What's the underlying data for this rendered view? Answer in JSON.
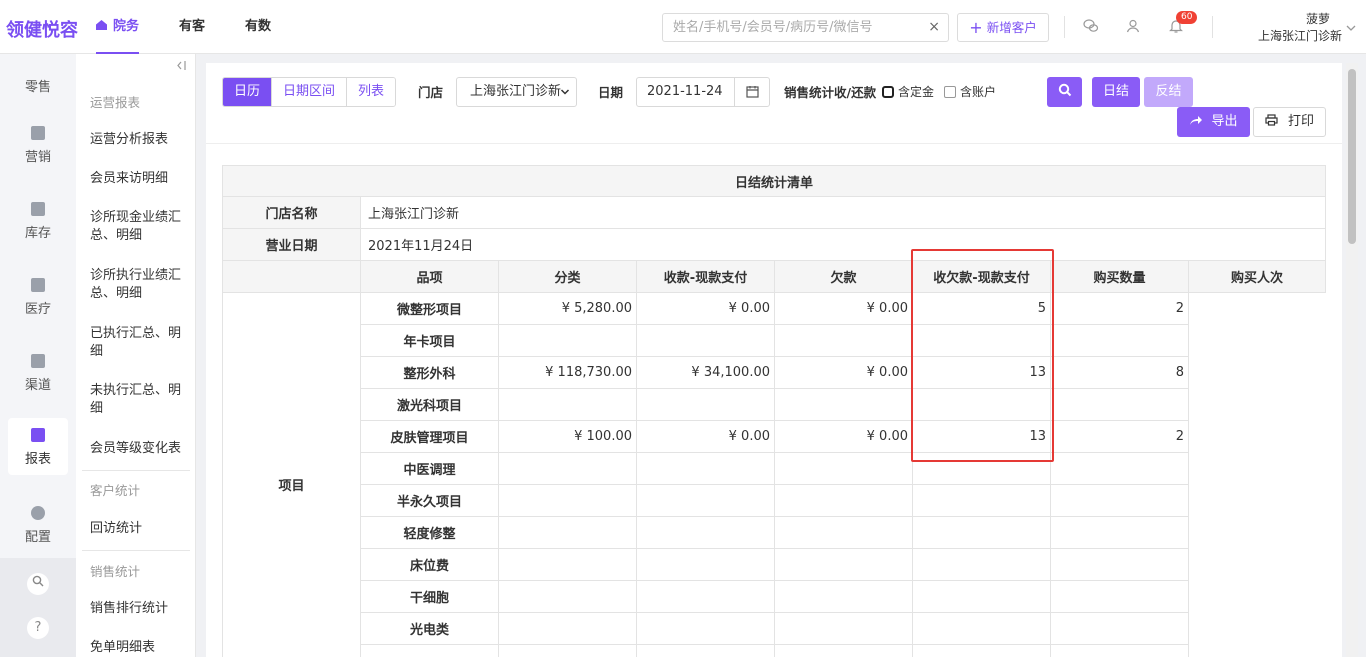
{
  "app": {
    "logo": "领健悦容"
  },
  "topnav": [
    {
      "label": "院务",
      "active": true
    },
    {
      "label": "有客",
      "active": false
    },
    {
      "label": "有数",
      "active": false
    }
  ],
  "search": {
    "placeholder": "姓名/手机号/会员号/病历号/微信号",
    "clear_icon": "×"
  },
  "add_customer": {
    "label": "新增客户"
  },
  "notifications": {
    "count": "60"
  },
  "user": {
    "name": "菠萝",
    "clinic": "上海张江门诊新"
  },
  "rail": [
    {
      "label": "零售",
      "icon": "retail-icon"
    },
    {
      "label": "营销",
      "icon": "marketing-icon"
    },
    {
      "label": "库存",
      "icon": "inventory-icon"
    },
    {
      "label": "医疗",
      "icon": "medical-icon"
    },
    {
      "label": "渠道",
      "icon": "channel-icon"
    },
    {
      "label": "报表",
      "icon": "report-icon",
      "active": true
    },
    {
      "label": "配置",
      "icon": "settings-icon"
    }
  ],
  "submenu": {
    "group_ops": "运营报表",
    "ops_items": [
      "运营分析报表",
      "会员来访明细",
      "诊所现金业绩汇总、明细",
      "诊所执行业绩汇总、明细",
      "已执行汇总、明细",
      "未执行汇总、明细",
      "会员等级变化表"
    ],
    "group_customer": "客户统计",
    "customer_items": [
      "回访统计"
    ],
    "group_sales": "销售统计",
    "sales_items": [
      "销售排行统计",
      "免单明细表"
    ]
  },
  "filters": {
    "view_tabs": [
      {
        "label": "日历",
        "active": true
      },
      {
        "label": "日期区间",
        "active": false
      },
      {
        "label": "列表",
        "active": false
      }
    ],
    "store_label": "门店",
    "store_value": "上海张江门诊新",
    "date_label": "日期",
    "date_value": "2021-11-24",
    "sales_stat_label": "销售统计收/还款",
    "include_deposit_label": "含定金",
    "include_account_label": "含账户",
    "settle_label": "日结",
    "unsettle_label": "反结",
    "export_label": "导出",
    "print_label": "打印"
  },
  "report": {
    "title": "日结统计清单",
    "store_name_label": "门店名称",
    "store_name_value": "上海张江门诊新",
    "business_date_label": "营业日期",
    "business_date_value": "2021年11月24日",
    "headers": [
      "品项",
      "分类",
      "收款-现款支付",
      "欠款",
      "收欠款-现款支付",
      "购买数量",
      "购买人次"
    ],
    "group_label": "项目",
    "rows": [
      [
        "微整形项目",
        "¥ 5,280.00",
        "¥ 0.00",
        "¥ 0.00",
        "5",
        "2"
      ],
      [
        "年卡项目",
        "",
        "",
        "",
        "",
        ""
      ],
      [
        "整形外科",
        "¥ 118,730.00",
        "¥ 34,100.00",
        "¥ 0.00",
        "13",
        "8"
      ],
      [
        "激光科项目",
        "",
        "",
        "",
        "",
        ""
      ],
      [
        "皮肤管理项目",
        "¥ 100.00",
        "¥ 0.00",
        "¥ 0.00",
        "13",
        "2"
      ],
      [
        "中医调理",
        "",
        "",
        "",
        "",
        ""
      ],
      [
        "半永久项目",
        "",
        "",
        "",
        "",
        ""
      ],
      [
        "轻度修整",
        "",
        "",
        "",
        "",
        ""
      ],
      [
        "床位费",
        "",
        "",
        "",
        "",
        ""
      ],
      [
        "干细胞",
        "",
        "",
        "",
        "",
        ""
      ],
      [
        "光电类",
        "",
        "",
        "",
        "",
        ""
      ],
      [
        "",
        "",
        "",
        "",
        "",
        ""
      ]
    ]
  }
}
